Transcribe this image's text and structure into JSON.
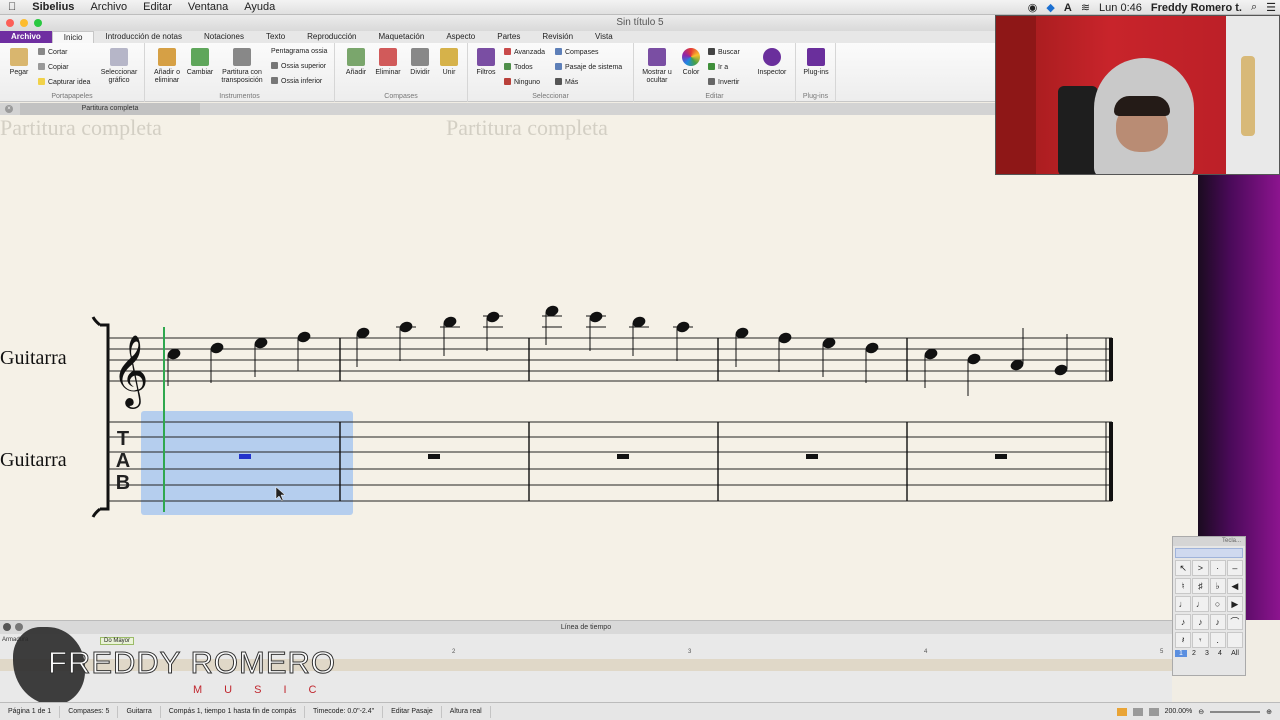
{
  "menubar": {
    "app": "Sibelius",
    "items": [
      "Archivo",
      "Editar",
      "Ventana",
      "Ayuda"
    ],
    "clock": "Lun 0:46",
    "user": "Freddy  Romero t."
  },
  "window": {
    "title": "Sin título 5"
  },
  "ribbon": {
    "tabs": [
      "Archivo",
      "Inicio",
      "Introducción de notas",
      "Notaciones",
      "Texto",
      "Reproducción",
      "Maquetación",
      "Aspecto",
      "Partes",
      "Revisión",
      "Vista"
    ],
    "active_tab": "Inicio",
    "clipboard": {
      "paste": "Pegar",
      "cut": "Cortar",
      "copy": "Copiar",
      "capture": "Capturar idea",
      "select_graphic": "Seleccionar gráfico",
      "label": "Portapapeles"
    },
    "instruments": {
      "add_remove": "Añadir o eliminar",
      "change": "Cambiar",
      "transpose": "Partitura con transposición",
      "ossia_staff": "Pentagrama ossia",
      "ossia_above": "Ossia superior",
      "ossia_below": "Ossia inferior",
      "label": "Instrumentos"
    },
    "bars": {
      "add": "Añadir",
      "delete": "Eliminar",
      "split": "Dividir",
      "join": "Unir",
      "label": "Compases"
    },
    "select": {
      "filters": "Filtros",
      "advanced": "Avanzada",
      "all": "Todos",
      "none": "Ninguno",
      "bars": "Compases",
      "system_passage": "Pasaje de sistema",
      "more": "Más",
      "label": "Seleccionar"
    },
    "edit": {
      "show_hide": "Mostrar u ocultar",
      "color": "Color",
      "find": "Buscar",
      "goto": "Ir a",
      "invert": "Invertir",
      "inspector": "Inspector",
      "label": "Editar"
    },
    "plugins": {
      "btn": "Plug-ins",
      "label": "Plug-ins"
    }
  },
  "doc_tab": "Partitura completa",
  "score": {
    "ghost_titles": [
      "Partitura completa",
      "Partitura completa"
    ],
    "instruments": [
      "Guitarra",
      "Guitarra"
    ],
    "tab_letters": [
      "T",
      "A",
      "B"
    ]
  },
  "keypad": {
    "title": "Tecla...",
    "rows": [
      [
        "↖",
        ">",
        "·",
        "–"
      ],
      [
        "♮",
        "♯",
        "♭",
        "◀"
      ],
      [
        "♩",
        "♩",
        "○",
        "▶"
      ],
      [
        "♪",
        "♪",
        "♪",
        "⌒"
      ],
      [
        "𝄽",
        "𝄾",
        ".",
        ""
      ]
    ],
    "tabs": [
      "1",
      "2",
      "3",
      "4",
      "All"
    ]
  },
  "timeline": {
    "title": "Línea de tiempo",
    "key_label": "Armadura",
    "key_value": "Do Mayor",
    "numbers": [
      "2",
      "3",
      "4",
      "5"
    ]
  },
  "logo": {
    "main": "FREDDY ROMERO",
    "sub": "MUSIC"
  },
  "status": {
    "page": "Página 1 de 1",
    "bars": "Compases: 5",
    "instrument": "Guitarra",
    "selection": "Compás 1, tiempo 1 hasta fin de compás",
    "timecode": "Timecode: 0.0\"-2.4\"",
    "mode": "Editar Pasaje",
    "pitch": "Altura real",
    "zoom": "200.00%"
  },
  "colors": {
    "accent": "#6f2ea1",
    "selection": "#a9c8ee",
    "caret": "#2fa84f",
    "logo_red": "#c0262e"
  }
}
